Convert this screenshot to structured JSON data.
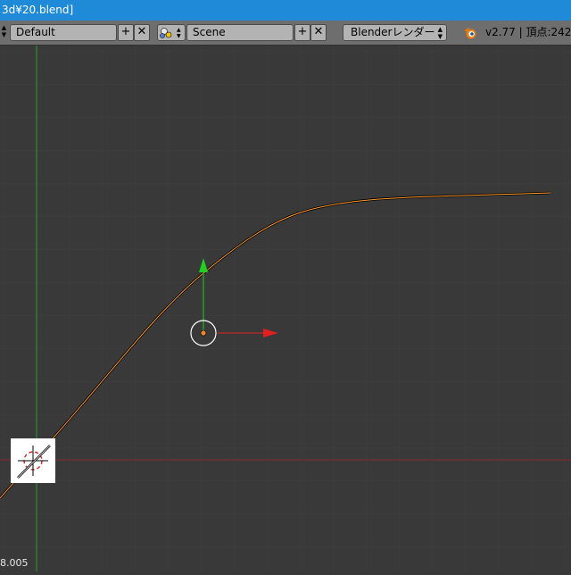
{
  "window": {
    "title_fragment": "3d¥20.blend]"
  },
  "header": {
    "screen_layout": "Default",
    "scene": "Scene",
    "render_engine": "Blenderレンダー",
    "version_info": "v2.77 | 頂点:242 |",
    "add_symbol": "+",
    "close_symbol": "✕",
    "engine_arrow": "▲▼"
  },
  "viewport": {
    "status_fragment": "8.005",
    "colors": {
      "background": "#393939",
      "grid": "#3f3f3f",
      "x_axis": "#8b2a2a",
      "y_axis": "#1f9f1f",
      "curve": "#ff9b2f",
      "gizmo_x": "#e02020",
      "gizmo_y": "#22d022"
    }
  }
}
